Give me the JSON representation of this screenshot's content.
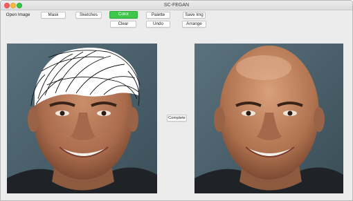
{
  "window": {
    "title": "SC-FEGAN"
  },
  "toolbar": {
    "open_image": "Open Image",
    "mask": "Mask",
    "sketches": "Sketches",
    "color": "Color",
    "palette": "Palette",
    "save_img": "Save Img",
    "clear": "Clear",
    "undo": "Undo",
    "arrange": "Arrange"
  },
  "active_tool": "color",
  "complete_button": "Complete",
  "colors": {
    "active_button": "#3ec74a",
    "window_bg": "#ececec",
    "canvas_bg": "#455a66"
  },
  "canvases": {
    "left": {
      "content": "face photo with white sketch strokes over hair"
    },
    "right": {
      "content": "generated face photo"
    }
  }
}
